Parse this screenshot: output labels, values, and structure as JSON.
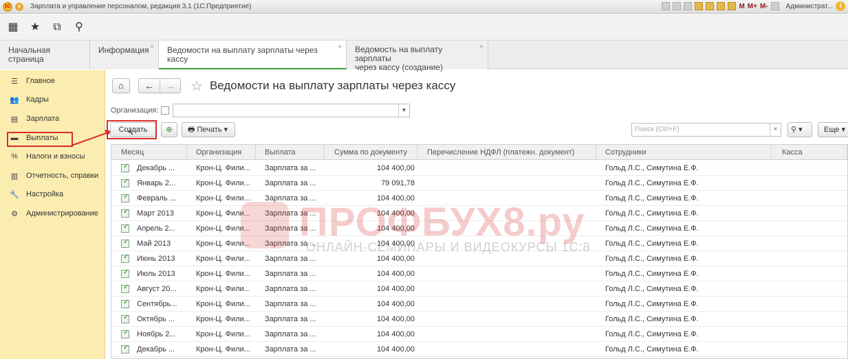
{
  "window": {
    "title": "Зарплата и управление персоналом, редакция 3.1  (1С:Предприятие)",
    "right_labels": {
      "m": "M",
      "mplus": "M+",
      "mminus": "M-",
      "user": "Администрат...",
      "help": "i"
    }
  },
  "toolbar_icons": [
    "apps-grid-icon",
    "favorites-star-icon",
    "history-icon",
    "search-icon"
  ],
  "tabs": [
    {
      "label": "Начальная страница",
      "closable": false,
      "active": false
    },
    {
      "label": "Информация",
      "closable": true,
      "active": false
    },
    {
      "label": "Ведомости на выплату зарплаты через кассу",
      "closable": true,
      "active": true
    },
    {
      "label": "Ведомость на выплату зарплаты\nчерез кассу (создание)",
      "line1": "Ведомость на выплату зарплаты",
      "line2": "через кассу (создание)",
      "closable": true,
      "active": false
    }
  ],
  "sidebar": {
    "items": [
      {
        "label": "Главное",
        "icon": "menu-lines-icon"
      },
      {
        "label": "Кадры",
        "icon": "people-icon"
      },
      {
        "label": "Зарплата",
        "icon": "calculator-icon"
      },
      {
        "label": "Выплаты",
        "icon": "payments-icon",
        "highlighted": true
      },
      {
        "label": "Налоги и взносы",
        "icon": "percent-icon"
      },
      {
        "label": "Отчетность, справки",
        "icon": "reports-icon"
      },
      {
        "label": "Настройка",
        "icon": "wrench-icon"
      },
      {
        "label": "Администрирование",
        "icon": "gear-icon"
      }
    ]
  },
  "page": {
    "title": "Ведомости на выплату зарплаты через кассу",
    "organization_label": "Организация:",
    "organization_value": ""
  },
  "commands": {
    "create": "Создать",
    "print": "Печать",
    "search_placeholder": "Поиск (Ctrl+F)",
    "more": "Еще"
  },
  "grid": {
    "columns": [
      "Месяц",
      "Организация",
      "Выплата",
      "Сумма по документу",
      "Перечисление НДФЛ (платежн. документ)",
      "Сотрудники",
      "Касса"
    ],
    "rows": [
      [
        "Декабрь ...",
        "Крон-Ц. Фили...",
        "Зарплата за ...",
        "104 400,00",
        "",
        "Гольд Л.С., Симутина Е.Ф.",
        ""
      ],
      [
        "Январь 2...",
        "Крон-Ц. Фили...",
        "Зарплата за ...",
        "79 091,78",
        "",
        "Гольд Л.С., Симутина Е.Ф.",
        ""
      ],
      [
        "Февраль ...",
        "Крон-Ц. Фили...",
        "Зарплата за ...",
        "104 400,00",
        "",
        "Гольд Л.С., Симутина Е.Ф.",
        ""
      ],
      [
        "Март 2013",
        "Крон-Ц. Фили...",
        "Зарплата за ...",
        "104 400,00",
        "",
        "Гольд Л.С., Симутина Е.Ф.",
        ""
      ],
      [
        "Апрель 2...",
        "Крон-Ц. Фили...",
        "Зарплата за ...",
        "104 400,00",
        "",
        "Гольд Л.С., Симутина Е.Ф.",
        ""
      ],
      [
        "Май 2013",
        "Крон-Ц. Фили...",
        "Зарплата за ...",
        "104 400,00",
        "",
        "Гольд Л.С., Симутина Е.Ф.",
        ""
      ],
      [
        "Июнь 2013",
        "Крон-Ц. Фили...",
        "Зарплата за ...",
        "104 400,00",
        "",
        "Гольд Л.С., Симутина Е.Ф.",
        ""
      ],
      [
        "Июль 2013",
        "Крон-Ц. Фили...",
        "Зарплата за ...",
        "104 400,00",
        "",
        "Гольд Л.С., Симутина Е.Ф.",
        ""
      ],
      [
        "Август 20...",
        "Крон-Ц. Фили...",
        "Зарплата за ...",
        "104 400,00",
        "",
        "Гольд Л.С., Симутина Е.Ф.",
        ""
      ],
      [
        "Сентябрь...",
        "Крон-Ц. Фили...",
        "Зарплата за ...",
        "104 400,00",
        "",
        "Гольд Л.С., Симутина Е.Ф.",
        ""
      ],
      [
        "Октябрь ...",
        "Крон-Ц. Фили...",
        "Зарплата за ...",
        "104 400,00",
        "",
        "Гольд Л.С., Симутина Е.Ф.",
        ""
      ],
      [
        "Ноябрь 2...",
        "Крон-Ц. Фили...",
        "Зарплата за ...",
        "104 400,00",
        "",
        "Гольд Л.С., Симутина Е.Ф.",
        ""
      ],
      [
        "Декабрь ...",
        "Крон-Ц. Фили...",
        "Зарплата за ...",
        "104 400,00",
        "",
        "Гольд Л.С., Симутина Е.Ф.",
        ""
      ]
    ]
  },
  "watermark": {
    "brand": "ПРОФБУХ8.ру",
    "tagline": "ОНЛАЙН-СЕМИНАРЫ И ВИДЕОКУРСЫ 1С:8"
  },
  "colors": {
    "sidebar_bg": "#fbedb0",
    "highlight_red": "#d92b2b",
    "active_tab_green": "#3da33d"
  }
}
